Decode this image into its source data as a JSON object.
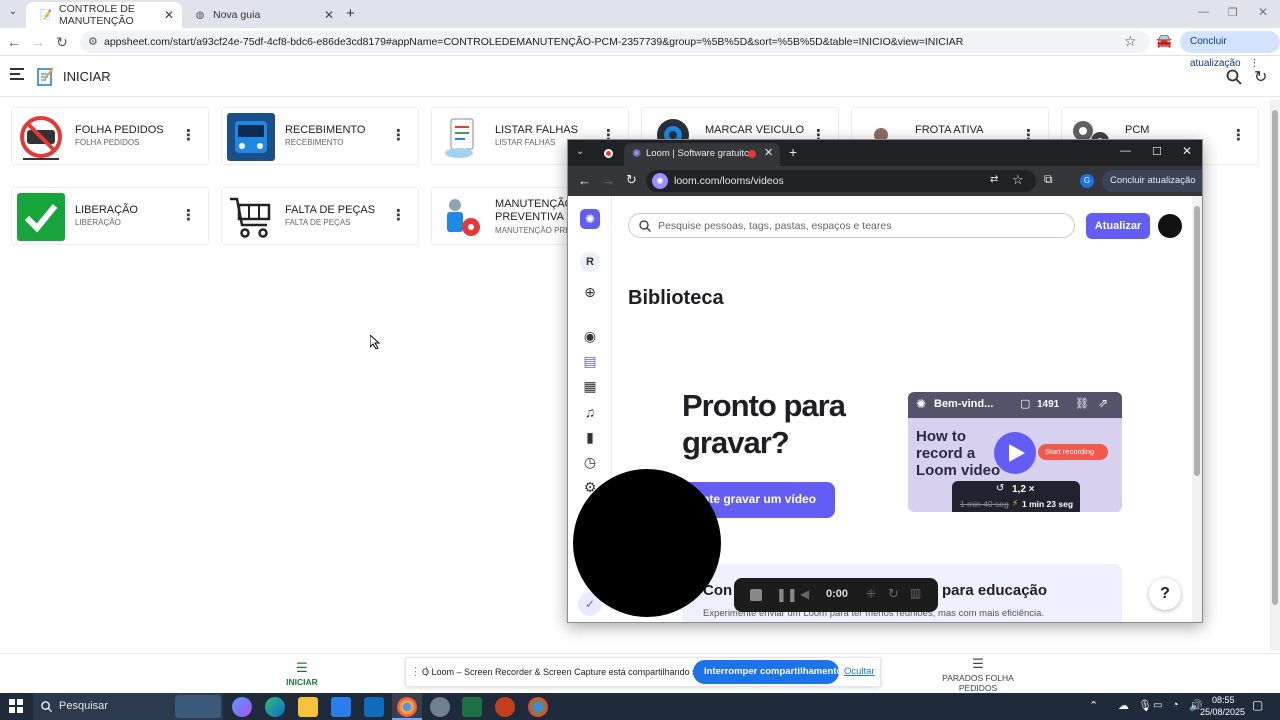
{
  "browser": {
    "tabs": [
      {
        "label": "CONTROLE DE MANUTENÇÃO",
        "active": true
      },
      {
        "label": "Nova guia",
        "active": false
      }
    ],
    "url": "appsheet.com/start/a93cf24e-75df-4cf8-bdc6-e86de3cd8179#appName=CONTROLEDEMANUTENÇÃO-PCM-2357739&group=%5B%5D&sort=%5B%5D&table=INICIO&view=INICIAR",
    "update_label": "Concluir atualização"
  },
  "app": {
    "title": "INICIAR",
    "cards": [
      {
        "title": "FOLHA PEDIDOS",
        "subtitle": "FOLHA PEDIDOS"
      },
      {
        "title": "RECEBIMENTO",
        "subtitle": "RECEBIMENTO"
      },
      {
        "title": "LISTAR FALHAS",
        "subtitle": "LISTAR FALHAS"
      },
      {
        "title": "MARCAR VEICULO",
        "subtitle": ""
      },
      {
        "title": "FROTA ATIVA",
        "subtitle": ""
      },
      {
        "title": "PCM",
        "subtitle": ""
      },
      {
        "title": "LIBERAÇÃO",
        "subtitle": "LIBERAÇÃO"
      },
      {
        "title": "FALTA DE PEÇAS",
        "subtitle": "FALTA DE PEÇAS"
      },
      {
        "title": "MANUTENÇÃO",
        "title2": "PREVENTIVA",
        "subtitle": "MANUTENÇÃO PREV"
      }
    ],
    "bottom_nav": {
      "left_label": "INICIAR",
      "right_label": "PARADOS FOLHA",
      "right_label2": "PEDIDOS"
    }
  },
  "loom": {
    "tab_title": "Loom | Software gratuito d",
    "url": "loom.com/looms/videos",
    "update_label": "Concluir atualização",
    "profile_letter": "G",
    "search_placeholder": "Pesquise pessoas, tags, pastas, espaços e teares",
    "upgrade_label": "Atualizar",
    "library_title": "Biblioteca",
    "side_initial": "R",
    "hero_line1": "Pronto para",
    "hero_line2": "gravar?",
    "cta_label": "nte gravar um vídeo",
    "video": {
      "title": "Bem-vind...",
      "comments": "1491",
      "thumb_line1": "How to",
      "thumb_line2": "record a",
      "thumb_line3": "Loom video",
      "thumb_button": "Start recording",
      "speed": "1,2 ×",
      "old_time": "1 min 40 seg",
      "new_time": "1 min 23 seg"
    },
    "edu_title_a": "Con",
    "edu_title_b": "para educação",
    "edu_sub": "Experimente enviar um Loom para ter menos reuniões, mas com mais eficiência.",
    "timer": "0:00",
    "help": "?"
  },
  "share": {
    "text": "O Loom – Screen Recorder & Screen Capture está compartilhando sua tela.",
    "stop_label": "Interromper compartilhamento",
    "hide_label": "Ocultar"
  },
  "taskbar": {
    "search_label": "Pesquisar",
    "time": "08:55",
    "date": "25/08/2025"
  }
}
